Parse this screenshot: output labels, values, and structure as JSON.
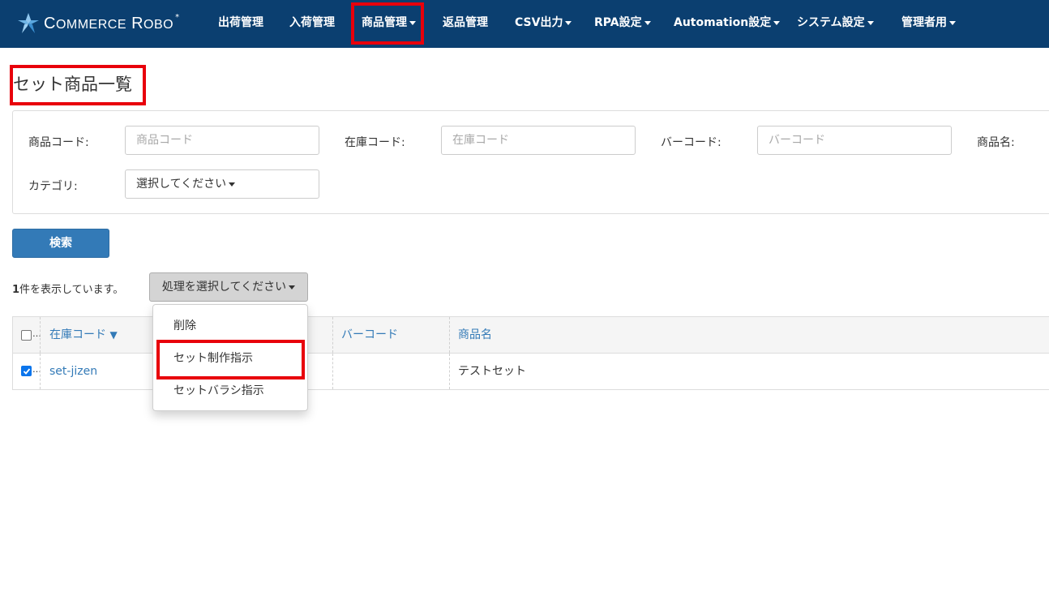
{
  "app": {
    "logo_text_main": "C",
    "logo_text_small": "OMMERCE",
    "logo_text_main2": "R",
    "logo_text_small2": "OBO",
    "logo_star": "*"
  },
  "nav": {
    "items": [
      {
        "label": "出荷管理",
        "dropdown": false
      },
      {
        "label": "入荷管理",
        "dropdown": false
      },
      {
        "label": "商品管理",
        "dropdown": true
      },
      {
        "label": "返品管理",
        "dropdown": false
      },
      {
        "label": "CSV出力",
        "dropdown": true
      },
      {
        "label": "RPA設定",
        "dropdown": true
      },
      {
        "label": "Automation設定",
        "dropdown": true
      },
      {
        "label": "システム設定",
        "dropdown": true
      },
      {
        "label": "管理者用",
        "dropdown": true
      }
    ]
  },
  "page": {
    "title": "セット商品一覧"
  },
  "filters": {
    "product_code_label": "商品コード:",
    "product_code_placeholder": "商品コード",
    "stock_code_label": "在庫コード:",
    "stock_code_placeholder": "在庫コード",
    "barcode_label": "バーコード:",
    "barcode_placeholder": "バーコード",
    "product_name_label": "商品名:",
    "category_label": "カテゴリ:",
    "category_value": "選択してください"
  },
  "actions": {
    "search_label": "検索",
    "count_number": "1",
    "count_suffix": "件を表示しています。",
    "process_select_label": "処理を選択してください",
    "menu": [
      "削除",
      "セット制作指示",
      "セットバラシ指示"
    ]
  },
  "table": {
    "headers": {
      "stock_code": "在庫コード",
      "sort_indicator": "▼",
      "barcode": "バーコード",
      "product_name": "商品名"
    },
    "rows": [
      {
        "checked": true,
        "stock_code": "set-jizen",
        "barcode": "",
        "product_name": "テストセット"
      }
    ],
    "ellipsis": "…"
  },
  "colors": {
    "navbar": "#0b3f70",
    "primary": "#337ab7",
    "highlight": "#e8000b",
    "checkbox": "#0b75ec"
  }
}
